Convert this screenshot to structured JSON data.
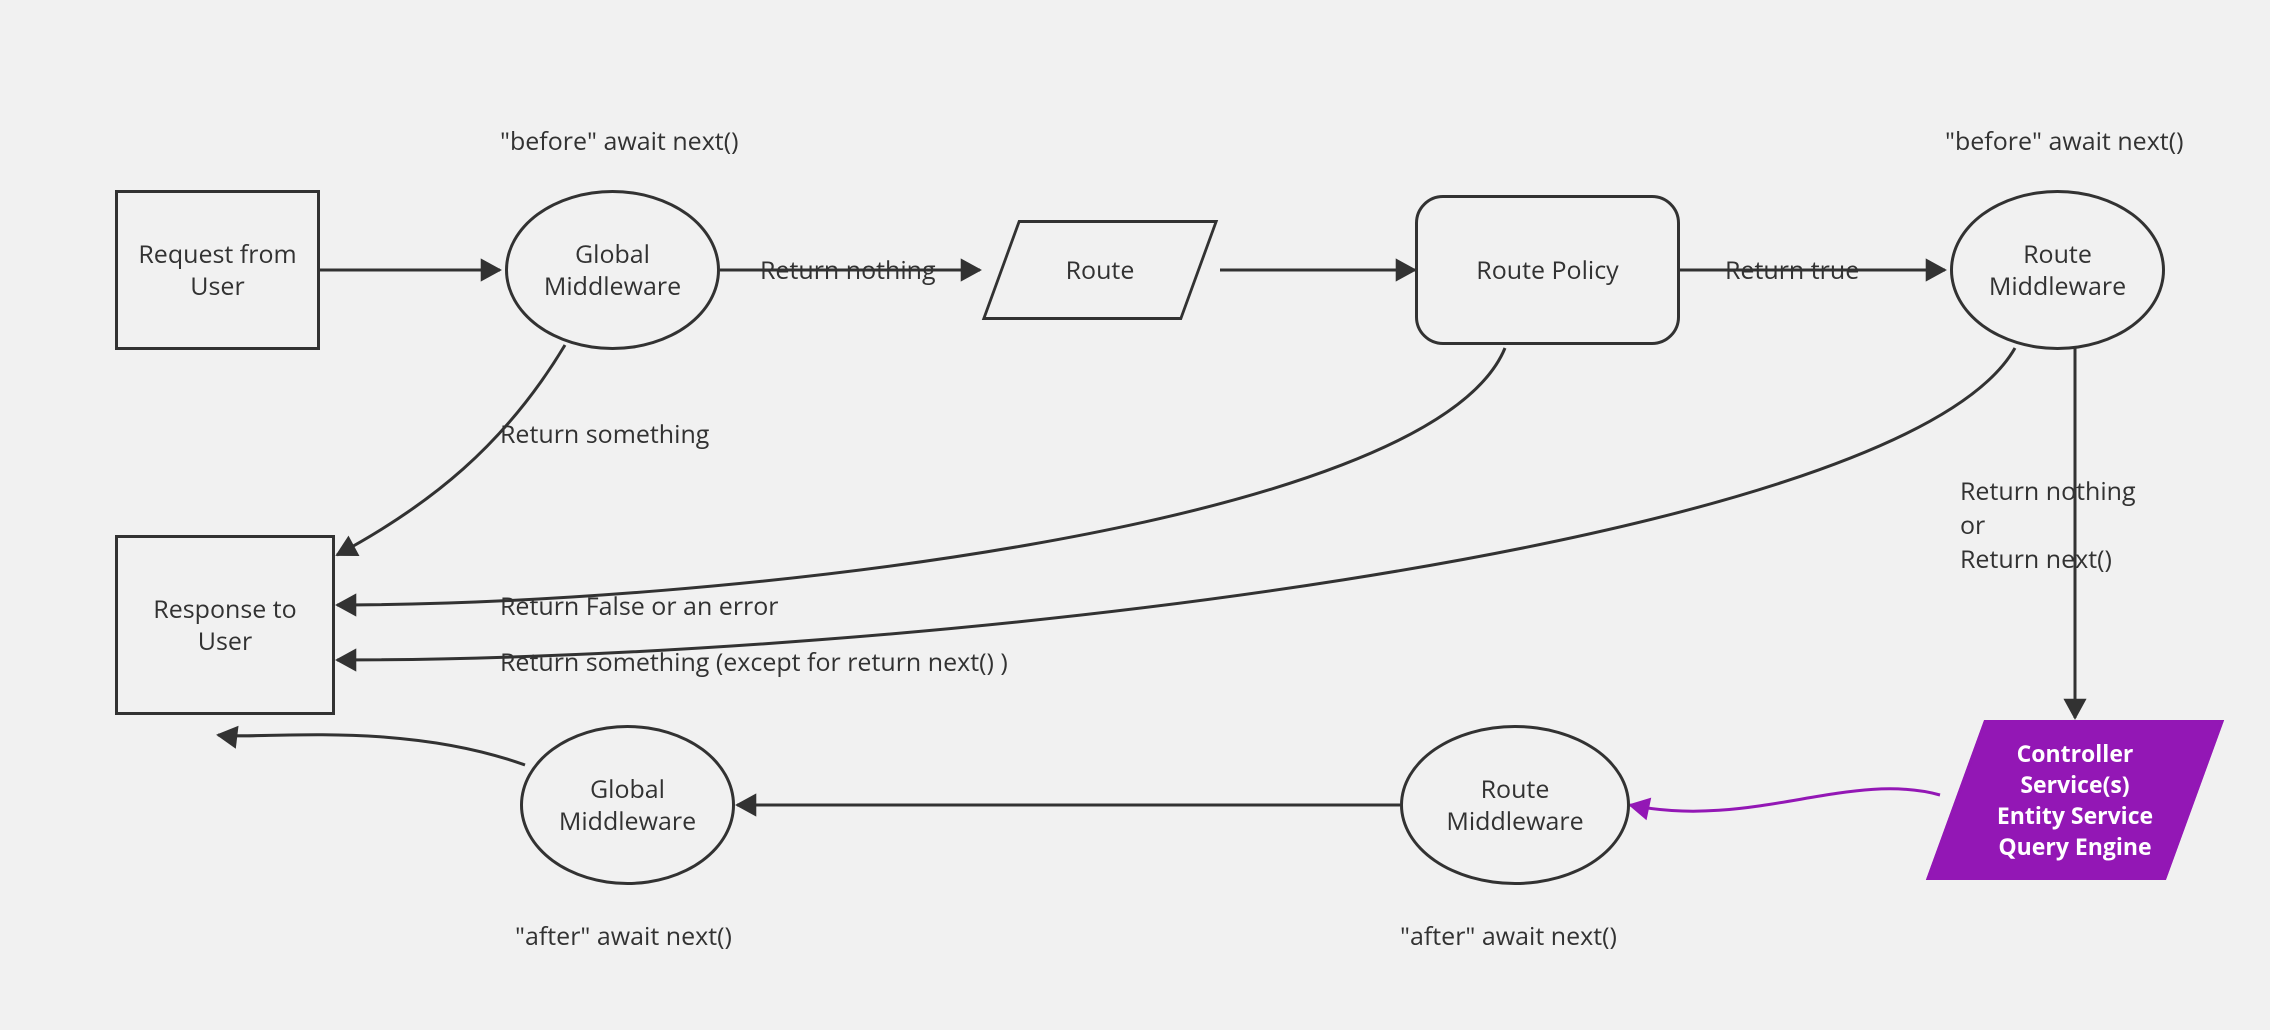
{
  "colors": {
    "bg": "#f1f1f1",
    "stroke": "#323232",
    "accent": "#9317b5"
  },
  "nodes": {
    "request": "Request from\nUser",
    "global_mw_before": "Global\nMiddleware",
    "route": "Route",
    "route_policy": "Route Policy",
    "route_mw_before": "Route\nMiddleware",
    "controller": "Controller\nService(s)\nEntity Service\nQuery Engine",
    "route_mw_after": "Route\nMiddleware",
    "global_mw_after": "Global\nMiddleware",
    "response": "Response to\nUser"
  },
  "annotations": {
    "before_global": "\"before\" await next()",
    "before_route": "\"before\" await next()",
    "after_global": "\"after\" await next()",
    "after_route": "\"after\" await next()"
  },
  "edge_labels": {
    "return_nothing": "Return nothing",
    "return_true": "Return true",
    "return_something": "Return something",
    "return_false_err": "Return False or an error",
    "return_something_except": "Return something (except for return next() )",
    "return_nothing_or_next": "Return nothing\nor\nReturn next()"
  }
}
